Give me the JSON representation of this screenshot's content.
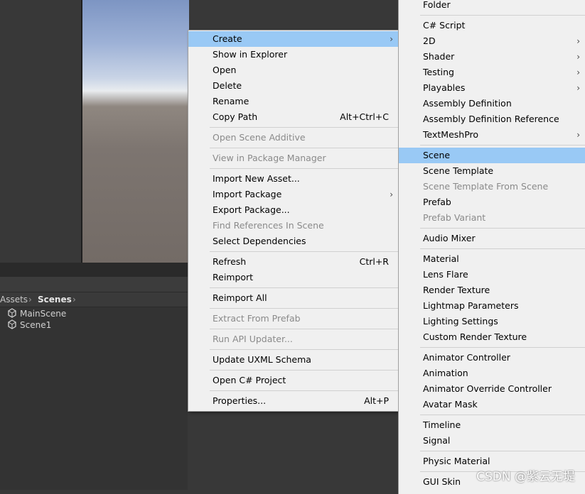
{
  "breadcrumb": {
    "root": "Assets",
    "current": "Scenes"
  },
  "files": [
    {
      "label": "MainScene"
    },
    {
      "label": "Scene1"
    }
  ],
  "context_menu": {
    "items": [
      {
        "label": "Create",
        "highlighted": true,
        "submenu": true
      },
      {
        "label": "Show in Explorer"
      },
      {
        "label": "Open"
      },
      {
        "label": "Delete"
      },
      {
        "label": "Rename"
      },
      {
        "label": "Copy Path",
        "shortcut": "Alt+Ctrl+C"
      },
      {
        "label": "Open Scene Additive",
        "disabled": true
      },
      {
        "label": "View in Package Manager",
        "disabled": true
      },
      {
        "label": "Import New Asset..."
      },
      {
        "label": "Import Package",
        "submenu": true
      },
      {
        "label": "Export Package..."
      },
      {
        "label": "Find References In Scene",
        "disabled": true
      },
      {
        "label": "Select Dependencies"
      },
      {
        "label": "Refresh",
        "shortcut": "Ctrl+R"
      },
      {
        "label": "Reimport"
      },
      {
        "label": "Reimport All"
      },
      {
        "label": "Extract From Prefab",
        "disabled": true
      },
      {
        "label": "Run API Updater...",
        "disabled": true
      },
      {
        "label": "Update UXML Schema"
      },
      {
        "label": "Open C# Project"
      },
      {
        "label": "Properties...",
        "shortcut": "Alt+P"
      }
    ]
  },
  "create_submenu": {
    "items": [
      {
        "label": "Folder"
      },
      {
        "label": "C# Script"
      },
      {
        "label": "2D",
        "submenu": true
      },
      {
        "label": "Shader",
        "submenu": true
      },
      {
        "label": "Testing",
        "submenu": true
      },
      {
        "label": "Playables",
        "submenu": true
      },
      {
        "label": "Assembly Definition"
      },
      {
        "label": "Assembly Definition Reference"
      },
      {
        "label": "TextMeshPro",
        "submenu": true
      },
      {
        "label": "Scene",
        "highlighted": true
      },
      {
        "label": "Scene Template"
      },
      {
        "label": "Scene Template From Scene",
        "disabled": true
      },
      {
        "label": "Prefab"
      },
      {
        "label": "Prefab Variant",
        "disabled": true
      },
      {
        "label": "Audio Mixer"
      },
      {
        "label": "Material"
      },
      {
        "label": "Lens Flare"
      },
      {
        "label": "Render Texture"
      },
      {
        "label": "Lightmap Parameters"
      },
      {
        "label": "Lighting Settings"
      },
      {
        "label": "Custom Render Texture"
      },
      {
        "label": "Animator Controller"
      },
      {
        "label": "Animation"
      },
      {
        "label": "Animator Override Controller"
      },
      {
        "label": "Avatar Mask"
      },
      {
        "label": "Timeline"
      },
      {
        "label": "Signal"
      },
      {
        "label": "Physic Material"
      },
      {
        "label": "GUI Skin"
      }
    ]
  },
  "watermark": "CSDN @紫云无堤",
  "colors": {
    "highlight": "#99c9f5",
    "menu_bg": "#f0f0f0",
    "disabled": "#8a8a8a",
    "editor_bg": "#383838"
  }
}
